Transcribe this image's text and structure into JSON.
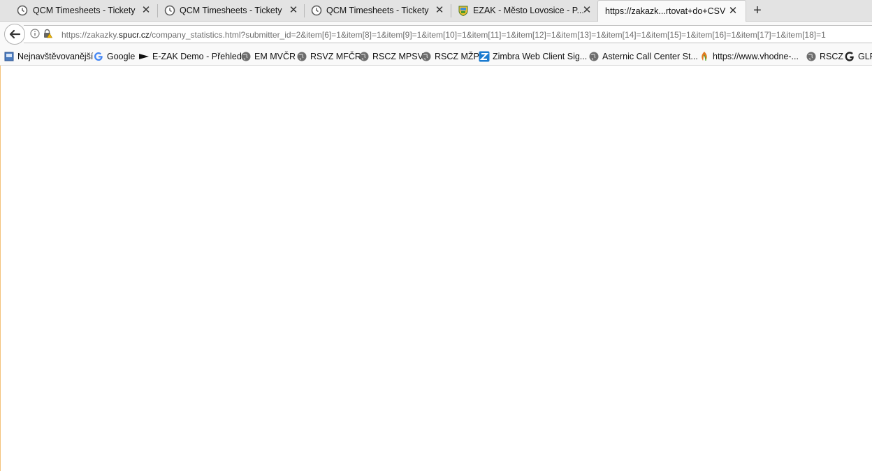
{
  "tabs": [
    {
      "title": "QCM Timesheets - Tickety",
      "icon": "clock-icon",
      "active": false
    },
    {
      "title": "QCM Timesheets - Tickety",
      "icon": "clock-icon",
      "active": false
    },
    {
      "title": "QCM Timesheets - Tickety",
      "icon": "clock-icon",
      "active": false
    },
    {
      "title": "EZAK - Město Lovosice - P...",
      "icon": "city-crest-icon",
      "active": false
    },
    {
      "title": "https://zakazk...rtovat+do+CSV",
      "icon": "",
      "active": true
    }
  ],
  "new_tab_label": "+",
  "close_glyph": "✕",
  "url": {
    "prefix": "https://zakazky.",
    "domain": "spucr.cz",
    "path": "/company_statistics.html?submitter_id=2&item[6]=1&item[8]=1&item[9]=1&item[10]=1&item[11]=1&item[12]=1&item[13]=1&item[14]=1&item[15]=1&item[16]=1&item[17]=1&item[18]=1"
  },
  "bookmarks": [
    {
      "label": "Nejnavštěvovanější",
      "icon": "bookmark-page-icon"
    },
    {
      "label": "Google",
      "icon": "google-icon"
    },
    {
      "label": "E-ZAK Demo - Přehled",
      "icon": "flag-icon"
    },
    {
      "label": "EM MVČR",
      "icon": "globe-icon"
    },
    {
      "label": "RSVZ MFČR",
      "icon": "globe-icon"
    },
    {
      "label": "RSCZ MPSV",
      "icon": "globe-icon"
    },
    {
      "label": "RSCZ MŽP",
      "icon": "globe-icon"
    },
    {
      "label": "Zimbra Web Client Sig...",
      "icon": "zimbra-icon"
    },
    {
      "label": "Asternic Call Center St...",
      "icon": "globe-icon"
    },
    {
      "label": "https://www.vhodne-...",
      "icon": "leaf-icon"
    },
    {
      "label": "RSCZ",
      "icon": "globe-icon"
    },
    {
      "label": "GLP",
      "icon": "glp-icon"
    }
  ],
  "colors": {
    "tabstrip_bg": "#e3e3e3",
    "toolbar_bg": "#f9f9f9",
    "url_domain": "#111111",
    "url_muted": "#707070"
  }
}
